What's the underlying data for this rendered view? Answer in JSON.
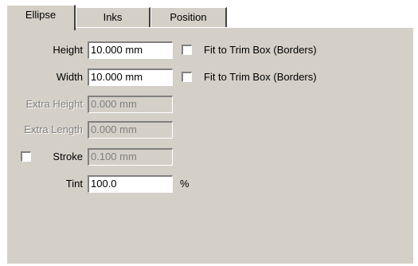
{
  "tabs": [
    {
      "label": "Ellipse",
      "active": true
    },
    {
      "label": "Inks",
      "active": false
    },
    {
      "label": "Position",
      "active": false
    }
  ],
  "form": {
    "height": {
      "label": "Height",
      "value": "10.000 mm",
      "fit_label": "Fit to Trim Box (Borders)",
      "fit_checked": false
    },
    "width": {
      "label": "Width",
      "value": "10.000 mm",
      "fit_label": "Fit to Trim Box (Borders)",
      "fit_checked": false
    },
    "extra_height": {
      "label": "Extra Height",
      "value": "0.000 mm",
      "disabled": true
    },
    "extra_length": {
      "label": "Extra Length",
      "value": "0.000 mm",
      "disabled": true
    },
    "stroke": {
      "label": "Stroke",
      "value": "0.100 mm",
      "checked": false,
      "disabled": true
    },
    "tint": {
      "label": "Tint",
      "value": "100.0",
      "unit": "%"
    }
  }
}
